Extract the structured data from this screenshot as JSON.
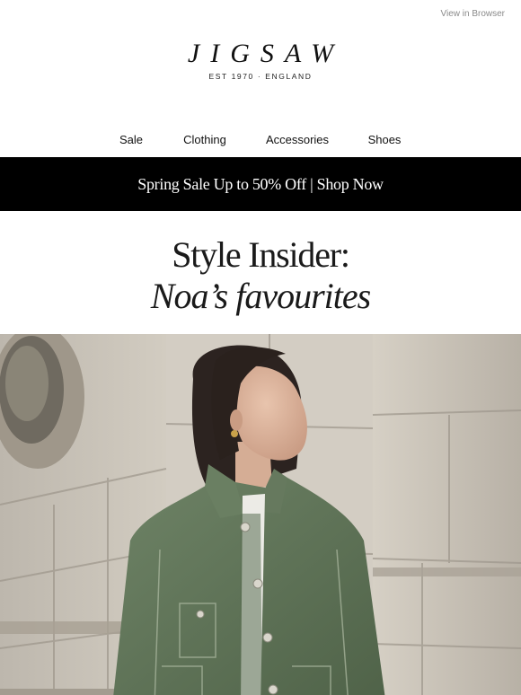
{
  "topbar": {
    "view_in_browser": "View in Browser"
  },
  "brand": {
    "logo_text": "JIGSAW",
    "tagline": "EST 1970   ·   ENGLAND"
  },
  "nav": {
    "items": [
      {
        "label": "Sale"
      },
      {
        "label": "Clothing"
      },
      {
        "label": "Accessories"
      },
      {
        "label": "Shoes"
      }
    ]
  },
  "promo": {
    "text": "Spring Sale Up to 50% Off | Shop Now"
  },
  "headline": {
    "line1": "Style Insider:",
    "line2": "Noa’s favourites"
  },
  "hero": {
    "image_alt": "hero-photo"
  },
  "colors": {
    "banner_bg": "#000000",
    "banner_text": "#ffffff",
    "jacket_green": "#5f7458",
    "stone": "#cfc8bc"
  }
}
